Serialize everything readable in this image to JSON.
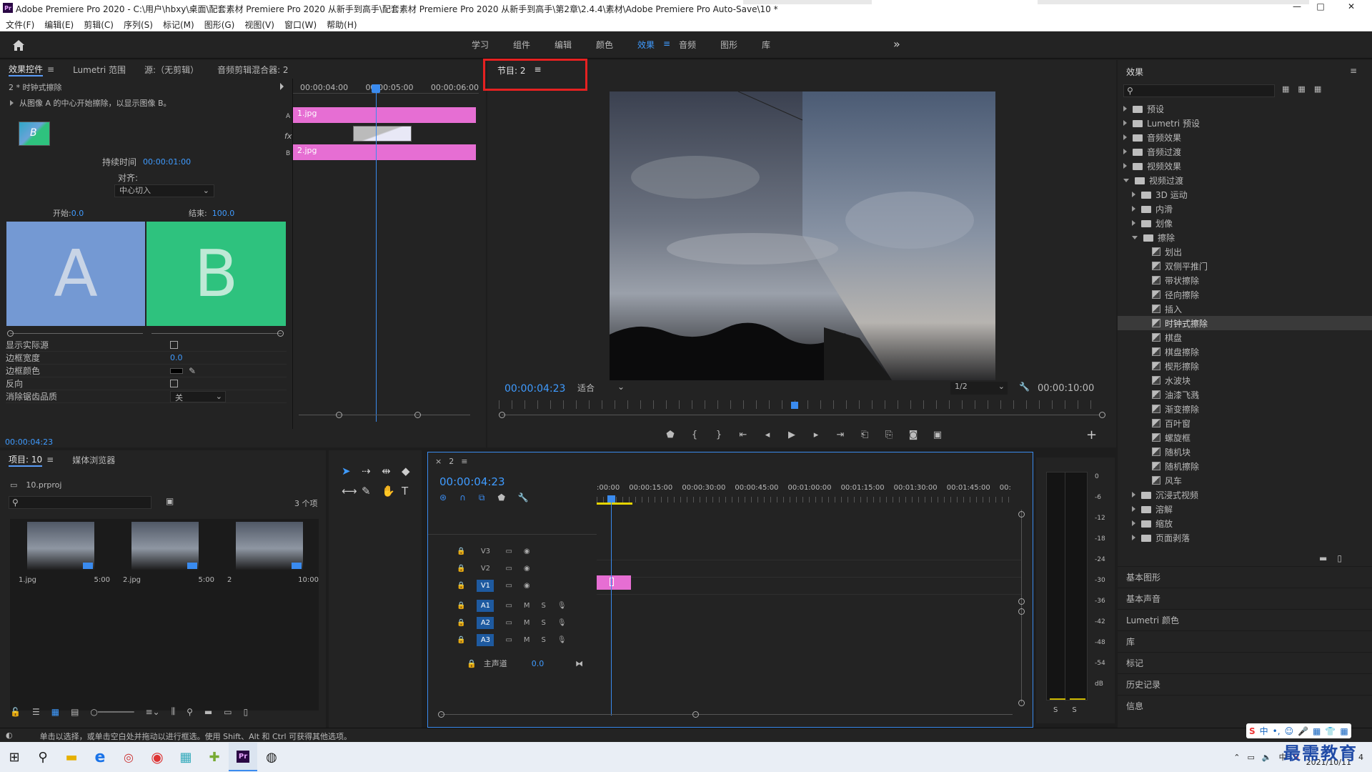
{
  "window": {
    "title": "Adobe Premiere Pro 2020 - C:\\用户\\hbxy\\桌面\\配套素材 Premiere Pro 2020 从新手到高手\\配套素材 Premiere Pro 2020 从新手到高手\\第2章\\2.4.4\\素材\\Adobe Premiere Pro Auto-Save\\10 *",
    "minimize": "—",
    "maximize": "□",
    "close": "✕"
  },
  "menu": [
    "文件(F)",
    "编辑(E)",
    "剪辑(C)",
    "序列(S)",
    "标记(M)",
    "图形(G)",
    "视图(V)",
    "窗口(W)",
    "帮助(H)"
  ],
  "workspaces": [
    "学习",
    "组件",
    "编辑",
    "颜色",
    "效果",
    "音频",
    "图形",
    "库"
  ],
  "workspace_active": "效果",
  "workspace_more": "»",
  "effect_controls": {
    "tabs": [
      "效果控件",
      "Lumetri 范围",
      "源:（无剪辑）",
      "音频剪辑混合器: 2"
    ],
    "tab_menu": "≡",
    "clip_label": "2 * 时钟式擦除",
    "description": "从图像 A 的中心开始擦除，以显示图像 B。",
    "duration_label": "持续时间",
    "duration_value": "00:00:01:00",
    "align_label": "对齐:",
    "align_value": "中心切入",
    "start_label": "开始:",
    "start_value": "0.0",
    "end_label": "结束:",
    "end_value": "100.0",
    "a_label": "A",
    "b_label": "B",
    "a_color": "#7499d3",
    "b_color": "#2ec27e",
    "props": [
      {
        "label": "显示实际源",
        "value": ""
      },
      {
        "label": "边框宽度",
        "value": "0.0"
      },
      {
        "label": "边框颜色",
        "value": ""
      },
      {
        "label": "反向",
        "value": ""
      },
      {
        "label": "消除锯齿品质",
        "value": "关"
      }
    ],
    "timecode": "00:00:04:23",
    "mini_ruler": [
      "00:00:04:00",
      "00:00:05:00",
      "00:00:06:00"
    ],
    "clip_a": "1.jpg",
    "clip_b": "2.jpg",
    "track_a": "A",
    "track_b": "B",
    "fx": "fx"
  },
  "program": {
    "tab": "节目: 2",
    "tab_menu": "≡",
    "timecode": "00:00:04:23",
    "fit": "适合",
    "quality": "1/2",
    "duration": "00:00:10:00",
    "add": "+"
  },
  "effects_panel": {
    "title": "效果",
    "menu": "≡",
    "tree": [
      {
        "label": "预设",
        "level": 0,
        "type": "folder",
        "open": false
      },
      {
        "label": "Lumetri 预设",
        "level": 0,
        "type": "folder",
        "open": false
      },
      {
        "label": "音频效果",
        "level": 0,
        "type": "folder",
        "open": false
      },
      {
        "label": "音频过渡",
        "level": 0,
        "type": "folder",
        "open": false
      },
      {
        "label": "视频效果",
        "level": 0,
        "type": "folder",
        "open": false
      },
      {
        "label": "视频过渡",
        "level": 0,
        "type": "folder",
        "open": true
      },
      {
        "label": "3D 运动",
        "level": 1,
        "type": "folder",
        "open": false
      },
      {
        "label": "内滑",
        "level": 1,
        "type": "folder",
        "open": false
      },
      {
        "label": "划像",
        "level": 1,
        "type": "folder",
        "open": false
      },
      {
        "label": "擦除",
        "level": 1,
        "type": "folder",
        "open": true
      },
      {
        "label": "划出",
        "level": 2,
        "type": "fx"
      },
      {
        "label": "双侧平推门",
        "level": 2,
        "type": "fx"
      },
      {
        "label": "带状擦除",
        "level": 2,
        "type": "fx"
      },
      {
        "label": "径向擦除",
        "level": 2,
        "type": "fx"
      },
      {
        "label": "插入",
        "level": 2,
        "type": "fx"
      },
      {
        "label": "时钟式擦除",
        "level": 2,
        "type": "fx",
        "selected": true
      },
      {
        "label": "棋盘",
        "level": 2,
        "type": "fx"
      },
      {
        "label": "棋盘擦除",
        "level": 2,
        "type": "fx"
      },
      {
        "label": "楔形擦除",
        "level": 2,
        "type": "fx"
      },
      {
        "label": "水波块",
        "level": 2,
        "type": "fx"
      },
      {
        "label": "油漆飞溅",
        "level": 2,
        "type": "fx"
      },
      {
        "label": "渐变擦除",
        "level": 2,
        "type": "fx"
      },
      {
        "label": "百叶窗",
        "level": 2,
        "type": "fx"
      },
      {
        "label": "螺旋框",
        "level": 2,
        "type": "fx"
      },
      {
        "label": "随机块",
        "level": 2,
        "type": "fx"
      },
      {
        "label": "随机擦除",
        "level": 2,
        "type": "fx"
      },
      {
        "label": "风车",
        "level": 2,
        "type": "fx"
      },
      {
        "label": "沉浸式视频",
        "level": 1,
        "type": "folder",
        "open": false
      },
      {
        "label": "溶解",
        "level": 1,
        "type": "folder",
        "open": false
      },
      {
        "label": "缩放",
        "level": 1,
        "type": "folder",
        "open": false
      },
      {
        "label": "页面剥落",
        "level": 1,
        "type": "folder",
        "open": false
      }
    ],
    "sections": [
      "基本图形",
      "基本声音",
      "Lumetri 颜色",
      "库",
      "标记",
      "历史记录",
      "信息"
    ]
  },
  "project": {
    "tabs": [
      "项目: 10",
      "媒体浏览器"
    ],
    "tab_menu": "≡",
    "file": "10.prproj",
    "count": "3 个项",
    "items": [
      {
        "name": "1.jpg",
        "duration": "5:00"
      },
      {
        "name": "2.jpg",
        "duration": "5:00"
      },
      {
        "name": "2",
        "duration": "10:00"
      }
    ]
  },
  "timeline": {
    "tab_close": "×",
    "tab": "2",
    "tab_menu": "≡",
    "timecode": "00:00:04:23",
    "ruler": [
      ":00:00",
      "00:00:15:00",
      "00:00:30:00",
      "00:00:45:00",
      "00:01:00:00",
      "00:01:15:00",
      "00:01:30:00",
      "00:01:45:00",
      "00:"
    ],
    "video_tracks": [
      "V3",
      "V2",
      "V1"
    ],
    "audio_tracks": [
      "A1",
      "A2",
      "A3"
    ],
    "master_label": "主声道",
    "master_value": "0.0",
    "mute": "M",
    "solo": "S"
  },
  "meter": {
    "scale": [
      "0",
      "-6",
      "-12",
      "-18",
      "-24",
      "-30",
      "-36",
      "-42",
      "-48",
      "-54",
      "dB"
    ],
    "solo_left": "S",
    "solo_right": "S"
  },
  "status": {
    "hint": "单击以选择，或单击空白处并拖动以进行框选。使用 Shift、Alt 和 Ctrl 可获得其他选项。"
  },
  "taskbar": {
    "ime": "中",
    "ime_punct": "•,",
    "date": "2021/10/11",
    "watermark": "最需教育",
    "notif": "4"
  }
}
